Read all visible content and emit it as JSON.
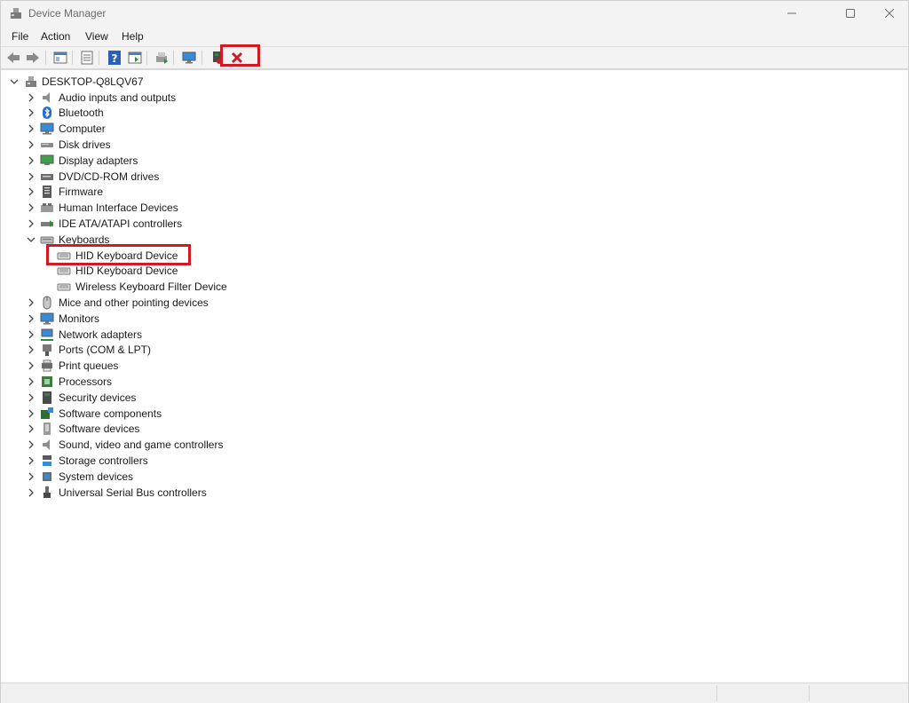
{
  "window": {
    "title": "Device Manager"
  },
  "menu": {
    "items": [
      "File",
      "Action",
      "View",
      "Help"
    ]
  },
  "toolbar": {
    "buttons": [
      "back-icon",
      "forward-icon",
      "show-hide-console-tree-icon",
      "properties-icon",
      "help-icon",
      "view-icon",
      "update-driver-icon",
      "scan-hardware-icon",
      "disable-device-icon",
      "uninstall-device-icon"
    ]
  },
  "tree": {
    "root": "DESKTOP-Q8LQV67",
    "categories": [
      "Audio inputs and outputs",
      "Bluetooth",
      "Computer",
      "Disk drives",
      "Display adapters",
      "DVD/CD-ROM drives",
      "Firmware",
      "Human Interface Devices",
      "IDE ATA/ATAPI controllers",
      "Keyboards",
      "Mice and other pointing devices",
      "Monitors",
      "Network adapters",
      "Ports (COM & LPT)",
      "Print queues",
      "Processors",
      "Security devices",
      "Software components",
      "Software devices",
      "Sound, video and game controllers",
      "Storage controllers",
      "System devices",
      "Universal Serial Bus controllers"
    ],
    "expanded_category": "Keyboards",
    "keyboard_devices": [
      "HID Keyboard Device",
      "HID Keyboard Device",
      "Wireless Keyboard Filter Device"
    ],
    "selected_device": "HID Keyboard Device"
  },
  "colors": {
    "highlight": "#d01b25",
    "background": "#ffffff",
    "chrome": "#f3f3f3"
  }
}
